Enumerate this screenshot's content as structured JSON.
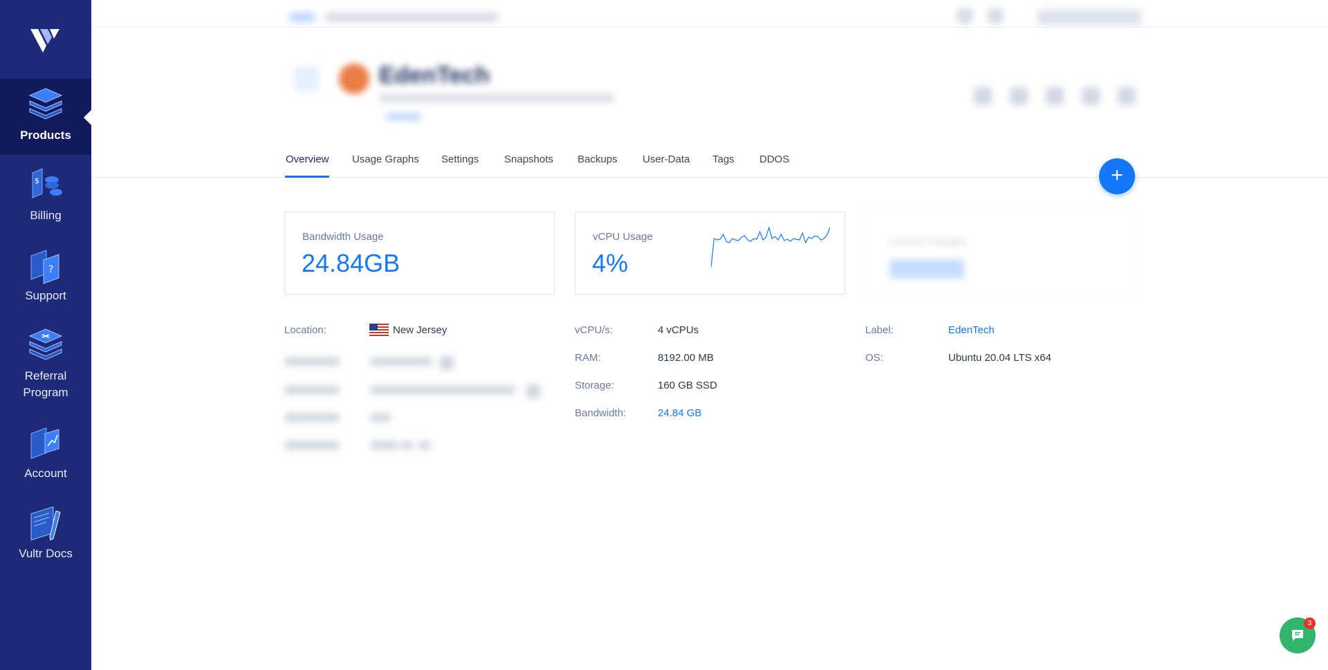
{
  "sidebar": {
    "logo": "vultr-logo",
    "items": [
      {
        "label": "Products",
        "icon": "products-icon",
        "active": true
      },
      {
        "label": "Billing",
        "icon": "billing-icon"
      },
      {
        "label": "Support",
        "icon": "support-icon"
      },
      {
        "label": "Referral Program",
        "icon": "referral-icon"
      },
      {
        "label": "Account",
        "icon": "account-icon"
      },
      {
        "label": "Vultr Docs",
        "icon": "docs-icon"
      }
    ]
  },
  "server": {
    "name": "EdenTech"
  },
  "tabs": [
    "Overview",
    "Usage Graphs",
    "Settings",
    "Snapshots",
    "Backups",
    "User-Data",
    "Tags",
    "DDOS"
  ],
  "fab": {
    "label": "+"
  },
  "cards": {
    "bandwidth": {
      "title": "Bandwidth Usage",
      "value": "24.84GB"
    },
    "vcpu": {
      "title": "vCPU Usage",
      "value": "4%",
      "sparkline": [
        0,
        42,
        40,
        41,
        48,
        38,
        36,
        42,
        40,
        39,
        44,
        46,
        40,
        38,
        42,
        41,
        52,
        40,
        44,
        58,
        42,
        45,
        40,
        48,
        39,
        41,
        38,
        42,
        41,
        40,
        50,
        36,
        44,
        42,
        46,
        45,
        40,
        42,
        47,
        58
      ]
    },
    "third": {
      "title": "Current Charges"
    }
  },
  "details": {
    "location": {
      "label": "Location:",
      "value": "New Jersey",
      "flag": "us-flag"
    },
    "vcpus": {
      "label": "vCPU/s:",
      "value": "4 vCPUs"
    },
    "ram": {
      "label": "RAM:",
      "value": "8192.00 MB"
    },
    "storage": {
      "label": "Storage:",
      "value": "160 GB SSD"
    },
    "bandwidth": {
      "label": "Bandwidth:",
      "value": "24.84 GB"
    },
    "label": {
      "label": "Label:",
      "value": "EdenTech"
    },
    "os": {
      "label": "OS:",
      "value": "Ubuntu 20.04 LTS x64"
    }
  },
  "chat": {
    "badge": "3"
  },
  "colors": {
    "sidebar": "#1e2a78",
    "accent": "#1477f8",
    "chat": "#31b46b"
  }
}
